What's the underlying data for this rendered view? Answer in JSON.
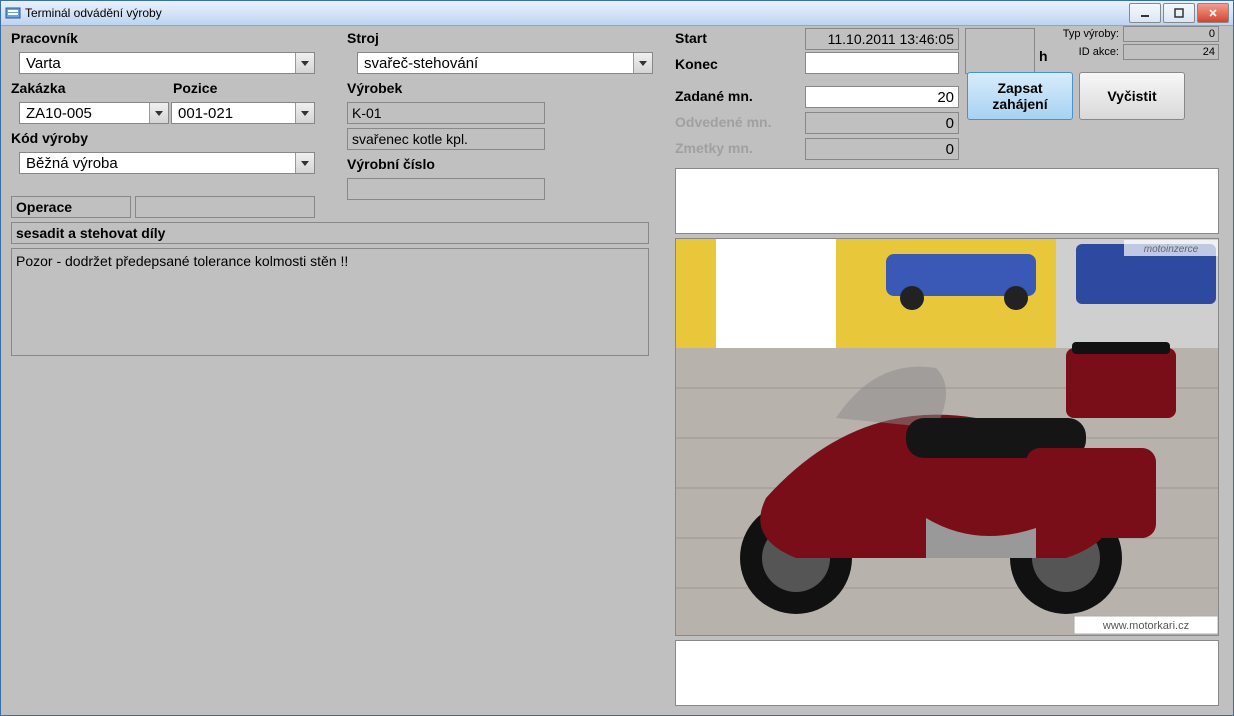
{
  "window": {
    "title": "Terminál odvádění výroby"
  },
  "labels": {
    "pracovnik": "Pracovník",
    "stroj": "Stroj",
    "zakazka": "Zakázka",
    "pozice": "Pozice",
    "vyrobek": "Výrobek",
    "kod_vyroby": "Kód výroby",
    "vyrobni_cislo": "Výrobní číslo",
    "operace": "Operace",
    "start": "Start",
    "konec": "Konec",
    "zadane": "Zadané mn.",
    "odvedene": "Odvedené mn.",
    "zmetky": "Zmetky mn.",
    "h": "h",
    "typ_vyroby": "Typ výroby:",
    "id_akce": "ID akce:"
  },
  "values": {
    "pracovnik": "Varta",
    "stroj": "svařeč-stehování",
    "zakazka": "ZA10-005",
    "pozice": "001-021",
    "vyrobek": "K-01",
    "vyrobek_popis": "svařenec kotle kpl.",
    "kod_vyroby": "Běžná výroba",
    "vyrobni_cislo": "",
    "operace_no": "",
    "operace_sub": "",
    "op_name": "sesadit a stehovat díly",
    "note": "Pozor - dodržet předepsané tolerance kolmosti stěn !!",
    "start": "11.10.2011 13:46:05",
    "konec": "",
    "zadane": "20",
    "odvedene": "0",
    "zmetky": "0",
    "hours": "",
    "typ_vyroby": "0",
    "id_akce": "24"
  },
  "buttons": {
    "zapsat": "Zapsat zahájení",
    "vycistit": "Vyčistit"
  }
}
